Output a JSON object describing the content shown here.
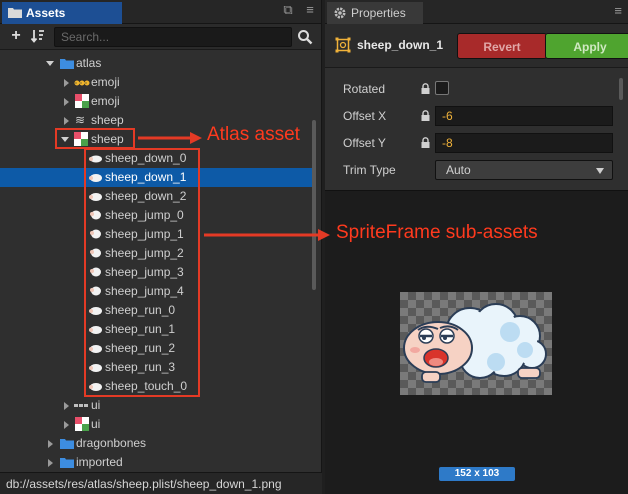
{
  "assets_panel": {
    "tab_title": "Assets",
    "search_placeholder": "Search...",
    "icons": {
      "tab": "folder-icon",
      "add": "plus-icon",
      "sort": "sort-icon",
      "search": "search-icon",
      "menu": "hamburger-menu-icon",
      "popout": "window-popout-icon"
    },
    "tree": [
      {
        "label": "atlas",
        "type": "folder",
        "expanded": true
      },
      {
        "label": "emoji",
        "type": "bitmap-font"
      },
      {
        "label": "emoji",
        "type": "texture"
      },
      {
        "label": "sheep",
        "type": "animation"
      },
      {
        "label": "sheep",
        "type": "atlas",
        "expanded": true
      },
      {
        "label": "sheep_down_0",
        "type": "sprite-frame"
      },
      {
        "label": "sheep_down_1",
        "type": "sprite-frame",
        "selected": true
      },
      {
        "label": "sheep_down_2",
        "type": "sprite-frame"
      },
      {
        "label": "sheep_jump_0",
        "type": "sprite-frame"
      },
      {
        "label": "sheep_jump_1",
        "type": "sprite-frame"
      },
      {
        "label": "sheep_jump_2",
        "type": "sprite-frame"
      },
      {
        "label": "sheep_jump_3",
        "type": "sprite-frame"
      },
      {
        "label": "sheep_jump_4",
        "type": "sprite-frame"
      },
      {
        "label": "sheep_run_0",
        "type": "sprite-frame"
      },
      {
        "label": "sheep_run_1",
        "type": "sprite-frame"
      },
      {
        "label": "sheep_run_2",
        "type": "sprite-frame"
      },
      {
        "label": "sheep_run_3",
        "type": "sprite-frame"
      },
      {
        "label": "sheep_touch_0",
        "type": "sprite-frame"
      },
      {
        "label": "ui",
        "type": "bitmap-font"
      },
      {
        "label": "ui",
        "type": "texture"
      },
      {
        "label": "dragonbones",
        "type": "folder"
      },
      {
        "label": "imported",
        "type": "folder"
      }
    ],
    "status_path": "db://assets/res/atlas/sheep.plist/sheep_down_1.png"
  },
  "properties_panel": {
    "tab_title": "Properties",
    "asset_name": "sheep_down_1",
    "revert_label": "Revert",
    "apply_label": "Apply",
    "rotated_label": "Rotated",
    "rotated_checked": false,
    "offset_x_label": "Offset X",
    "offset_x_value": "-6",
    "offset_y_label": "Offset Y",
    "offset_y_value": "-8",
    "trim_type_label": "Trim Type",
    "trim_type_value": "Auto",
    "preview_size": "152 x 103"
  },
  "annotations": {
    "atlas_asset": "Atlas asset",
    "sprite_frames": "SpriteFrame sub-assets"
  },
  "colors": {
    "selection": "#0d5aa7",
    "annotation": "#ff3a1e",
    "revert": "#a82a2a",
    "apply": "#4fa42f",
    "value_text": "#f0b23a"
  }
}
